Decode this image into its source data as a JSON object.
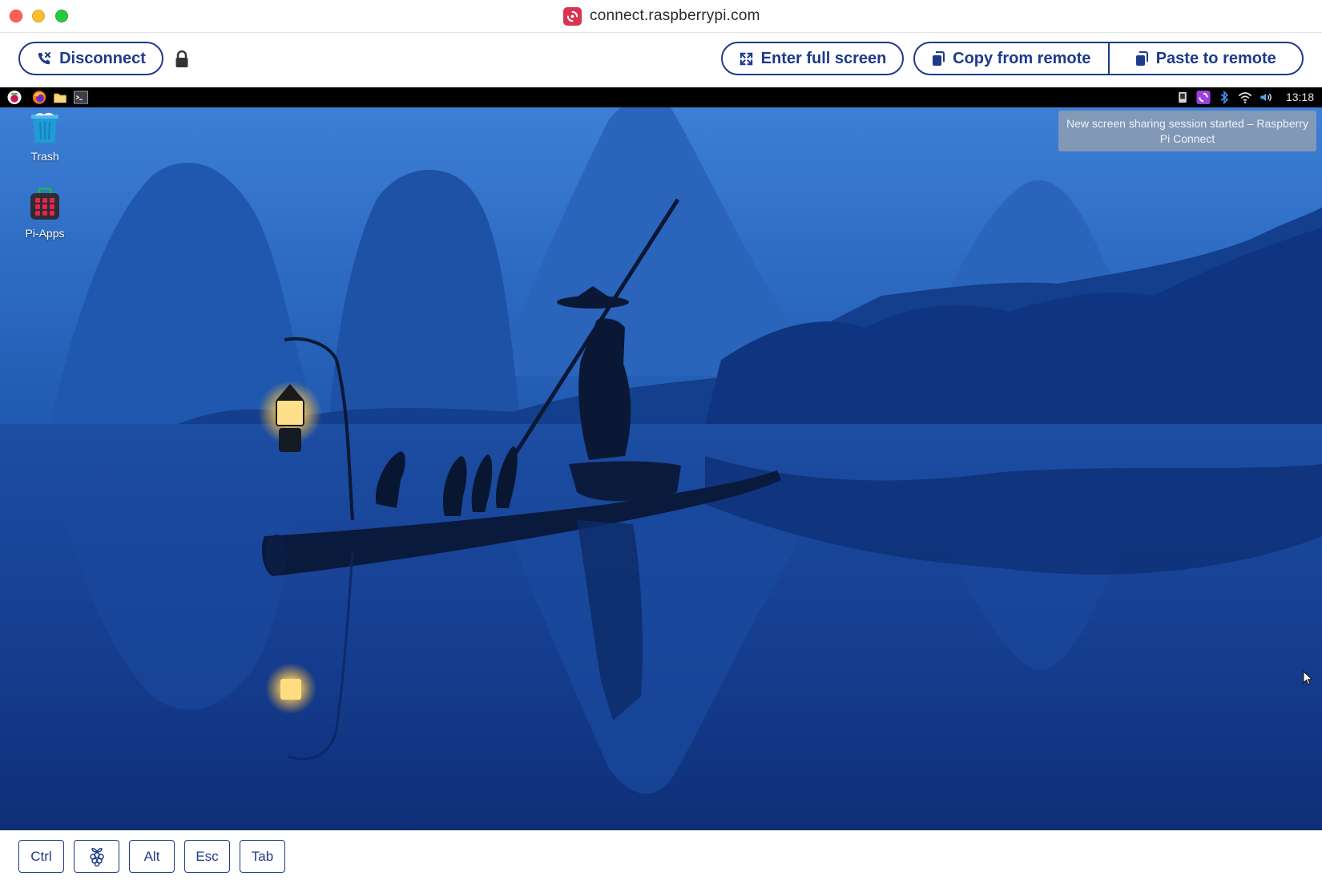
{
  "browser": {
    "url": "connect.raspberrypi.com",
    "site_icon": "raspberry-pi-connect-icon"
  },
  "toolbar": {
    "disconnect_label": "Disconnect",
    "lock_icon": "lock-icon",
    "fullscreen_label": "Enter full screen",
    "copy_label": "Copy from remote",
    "paste_label": "Paste to remote"
  },
  "remote_desktop": {
    "taskbar": {
      "launcher_icons": [
        "raspberry-menu-icon",
        "firefox-icon",
        "file-manager-icon",
        "terminal-icon"
      ],
      "tray_icons": [
        "network-icon",
        "connect-icon",
        "bluetooth-icon",
        "wifi-icon",
        "volume-icon"
      ],
      "clock": "13:18"
    },
    "desktop_icons": [
      {
        "label": "Trash",
        "icon": "trash-icon"
      },
      {
        "label": "Pi-Apps",
        "icon": "pi-apps-icon"
      }
    ],
    "notification": "New screen sharing session started – Raspberry Pi Connect",
    "wallpaper": "fisherman-on-bamboo-raft-at-dusk",
    "colors": {
      "sky": "#3f82d8",
      "water": "#123a86",
      "mountains": "#1b4aa0",
      "lantern": "#ffd36a"
    }
  },
  "keys": [
    "Ctrl",
    "raspberry-key",
    "Alt",
    "Esc",
    "Tab"
  ],
  "key_labels": {
    "ctrl": "Ctrl",
    "alt": "Alt",
    "esc": "Esc",
    "tab": "Tab"
  },
  "theme": {
    "accent": "#1e3a8a",
    "brand": "#d8344f"
  }
}
